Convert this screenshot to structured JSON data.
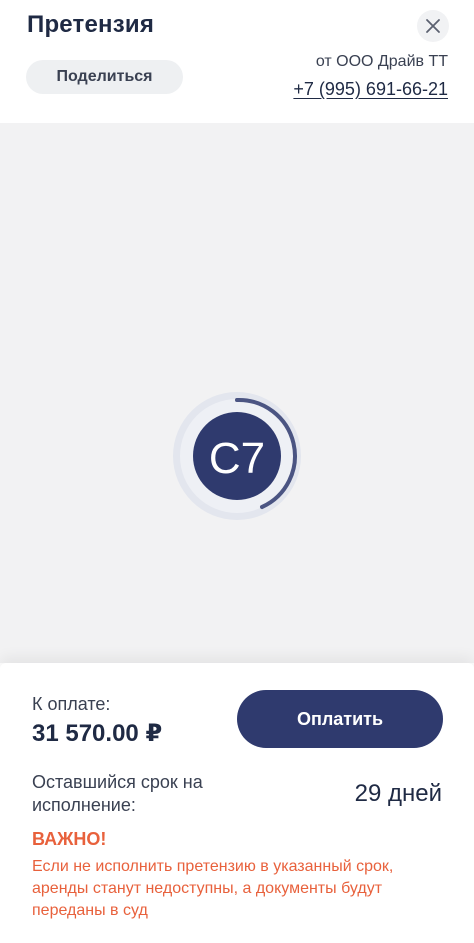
{
  "header": {
    "title": "Претензия",
    "share_label": "Поделиться",
    "sender": "от ООО Драйв ТТ",
    "phone": "+7 (995) 691-66-21",
    "close_icon": "close-icon"
  },
  "viewer": {
    "loader_glyph": "С7",
    "loader_icon": "spinner-logo-icon"
  },
  "payment": {
    "label": "К оплате:",
    "amount": "31 570.00 ₽",
    "button_label": "Оплатить"
  },
  "term": {
    "label": "Оставшийся срок на исполнение:",
    "value": "29 дней"
  },
  "warning": {
    "title": "ВАЖНО!",
    "text": "Если не исполнить претензию в указанный срок, аренды станут недоступны, а документы будут переданы в суд"
  },
  "colors": {
    "brand": "#2f3a6e",
    "warning": "#e8613c",
    "text": "#1f2a44",
    "viewer_bg": "#f2f2f3"
  }
}
